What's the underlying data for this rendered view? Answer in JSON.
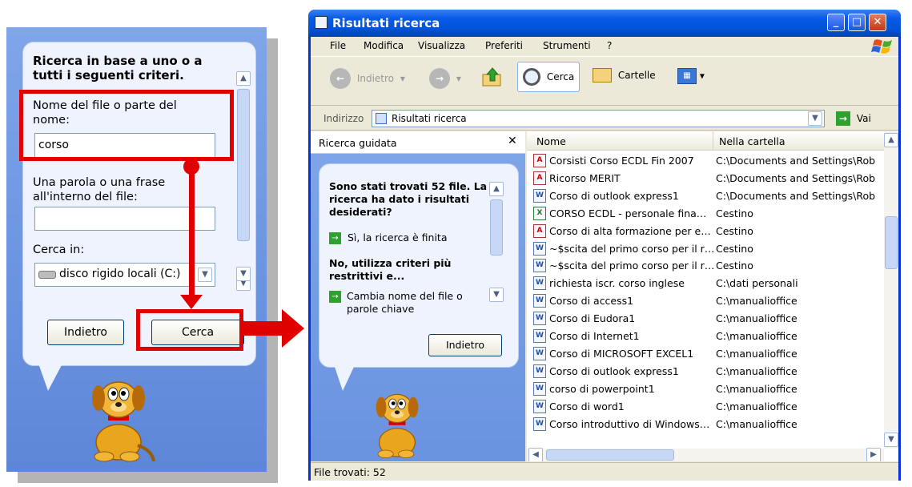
{
  "assistant": {
    "heading": "Ricerca in base a uno o a tutti i seguenti criteri.",
    "filename_label": "Nome del file o parte del nome:",
    "filename_value": "corso",
    "phrase_label": "Una parola o una frase all'interno del file:",
    "phrase_value": "",
    "lookin_label": "Cerca in:",
    "lookin_value": "disco rigido locali (C:)",
    "back_button": "Indietro",
    "search_button": "Cerca"
  },
  "window": {
    "title": "Risultati ricerca",
    "menu": [
      "File",
      "Modifica",
      "Visualizza",
      "Preferiti",
      "Strumenti",
      "?"
    ],
    "toolbar": {
      "back": "Indietro",
      "search": "Cerca",
      "folders": "Cartelle"
    },
    "address_label": "Indirizzo",
    "address_value": "Risultati ricerca",
    "go_label": "Vai",
    "pane_title": "Ricerca guidata",
    "pane": {
      "found": "Sono stati trovati 52 file. La ricerca ha dato i risultati desiderati?",
      "option_yes": "Sì, la ricerca è finita",
      "refine": "No, utilizza criteri più restrittivi e...",
      "option_rename": "Cambia nome del file o parole chiave",
      "back_button": "Indietro"
    },
    "columns": [
      "Nome",
      "Nella cartella"
    ],
    "files": [
      {
        "type": "pdf",
        "name": "Corsisti Corso ECDL Fin 2007",
        "folder": "C:\\Documents and Settings\\Rob"
      },
      {
        "type": "pdf",
        "name": "Ricorso MERIT",
        "folder": "C:\\Documents and Settings\\Rob"
      },
      {
        "type": "doc",
        "name": "Corso di outlook express1",
        "folder": "C:\\Documents and Settings\\Rob"
      },
      {
        "type": "xls",
        "name": "CORSO ECDL - personale fina…",
        "folder": "Cestino"
      },
      {
        "type": "pdf",
        "name": "Corso di alta formazione per e…",
        "folder": "Cestino"
      },
      {
        "type": "doc",
        "name": "~$scita del primo corso per il r…",
        "folder": "Cestino"
      },
      {
        "type": "doc",
        "name": "~$scita del primo corso per il r…",
        "folder": "Cestino"
      },
      {
        "type": "doc",
        "name": "richiesta iscr. corso inglese",
        "folder": "C:\\dati personali"
      },
      {
        "type": "doc",
        "name": "Corso di access1",
        "folder": "C:\\manualioffice"
      },
      {
        "type": "doc",
        "name": "Corso di Eudora1",
        "folder": "C:\\manualioffice"
      },
      {
        "type": "doc",
        "name": "Corso di Internet1",
        "folder": "C:\\manualioffice"
      },
      {
        "type": "doc",
        "name": "Corso di MICROSOFT EXCEL1",
        "folder": "C:\\manualioffice"
      },
      {
        "type": "doc",
        "name": "Corso di outlook express1",
        "folder": "C:\\manualioffice"
      },
      {
        "type": "doc",
        "name": "corso di powerpoint1",
        "folder": "C:\\manualioffice"
      },
      {
        "type": "doc",
        "name": "Corso di word1",
        "folder": "C:\\manualioffice"
      },
      {
        "type": "doc",
        "name": "Corso introduttivo di Windows…",
        "folder": "C:\\manualioffice"
      }
    ],
    "status": "File trovati: 52"
  }
}
